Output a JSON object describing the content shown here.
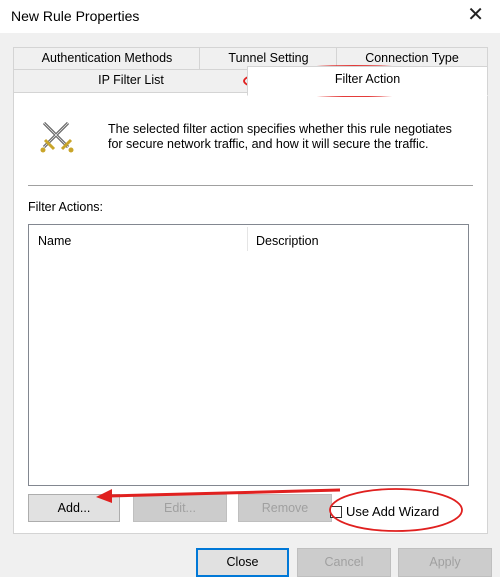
{
  "window": {
    "title": "New Rule Properties"
  },
  "tabs": {
    "row1": [
      "Authentication Methods",
      "Tunnel Setting",
      "Connection Type"
    ],
    "row2": [
      "IP Filter List",
      "Filter Action"
    ],
    "active": "Filter Action"
  },
  "panel": {
    "icon": "crossed-swords-icon",
    "description_line1": "The selected filter action specifies whether this rule negotiates",
    "description_line2": "for secure network traffic, and how it will secure the traffic.",
    "filter_actions_label": "Filter Actions:",
    "columns": [
      "Name",
      "Description"
    ],
    "rows": []
  },
  "buttons": {
    "add": "Add...",
    "edit": "Edit...",
    "remove": "Remove",
    "use_add_wizard": "Use Add Wizard",
    "use_add_wizard_checked": false
  },
  "footer": {
    "close": "Close",
    "cancel": "Cancel",
    "apply": "Apply"
  },
  "annotations": {
    "color": "#e0201f"
  }
}
